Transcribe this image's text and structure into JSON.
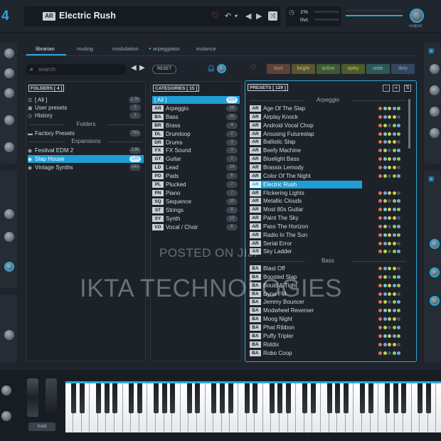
{
  "header": {
    "logo_number": "4",
    "preset_category_tag": "AR",
    "preset_name": "Electric Rush",
    "meter_line1": "1%",
    "meter_line2": "0vc",
    "output_label": "output"
  },
  "tabs": [
    "librarian",
    "routing",
    "modulation",
    "arpeggiator",
    "instance"
  ],
  "search": {
    "placeholder": "search"
  },
  "reset_label": "RESET",
  "tag_filters": [
    {
      "label": "dark",
      "color": "#5a4338",
      "text": "#c08a73"
    },
    {
      "label": "bright",
      "color": "#5a5530",
      "text": "#c8c070"
    },
    {
      "label": "active",
      "color": "#3f5a33",
      "text": "#8fcc6a"
    },
    {
      "label": "spiky",
      "color": "#4d5a2b",
      "text": "#b5cf5c"
    },
    {
      "label": "wide",
      "color": "#2f5658",
      "text": "#6fc7cb"
    },
    {
      "label": "dirty",
      "color": "#34465e",
      "text": "#84a6d6"
    }
  ],
  "folders": {
    "header": "FOLDERS [ 4 ]",
    "top_items": [
      {
        "label": "[ All ]",
        "count": "1.7k",
        "icon": "list-icon"
      },
      {
        "label": "User presets",
        "count": "0",
        "icon": "user-icon"
      },
      {
        "label": "History",
        "count": "1",
        "icon": "clock-icon"
      }
    ],
    "folders_heading": "Folders",
    "factory": {
      "label": "Factory Presets",
      "count": "763"
    },
    "expansions_heading": "Expansions",
    "expansions": [
      {
        "label": "Festival EDM 2",
        "count": "136"
      },
      {
        "label": "Slap House",
        "count": "129",
        "selected": true
      },
      {
        "label": "Vintage Synths",
        "count": "540"
      }
    ]
  },
  "categories": {
    "header": "CATEGORIES [ 15 ]",
    "items": [
      {
        "abbr": "",
        "label": "[ All ]",
        "count": "129",
        "selected": true
      },
      {
        "abbr": "AR",
        "label": "Arpeggio",
        "count": "18"
      },
      {
        "abbr": "BA",
        "label": "Bass",
        "count": "20"
      },
      {
        "abbr": "BR",
        "label": "Brass",
        "count": "4"
      },
      {
        "abbr": "DL",
        "label": "Drumloop",
        "count": "2"
      },
      {
        "abbr": "DR",
        "label": "Drums",
        "count": "3"
      },
      {
        "abbr": "FX",
        "label": "FX Sound",
        "count": "3"
      },
      {
        "abbr": "GT",
        "label": "Guitar",
        "count": "2"
      },
      {
        "abbr": "LD",
        "label": "Lead",
        "count": "14"
      },
      {
        "abbr": "PD",
        "label": "Pads",
        "count": "6"
      },
      {
        "abbr": "PL",
        "label": "Plucked",
        "count": "7"
      },
      {
        "abbr": "PN",
        "label": "Piano",
        "count": "7"
      },
      {
        "abbr": "SQ",
        "label": "Sequence",
        "count": "20"
      },
      {
        "abbr": "ST",
        "label": "Strings",
        "count": "8"
      },
      {
        "abbr": "SY",
        "label": "Synth",
        "count": "13"
      },
      {
        "abbr": "VO",
        "label": "Vocal / Choir",
        "count": "6"
      }
    ]
  },
  "presets": {
    "header": "PRESETS [ 129 ]",
    "buttons": [
      "-",
      "+",
      "⇅"
    ],
    "section_arpeggio": "Arpeggio",
    "arpeggio": [
      {
        "abbr": "AR",
        "label": "Age Of The Slap"
      },
      {
        "abbr": "AR",
        "label": "Airplay Knock"
      },
      {
        "abbr": "AR",
        "label": "Android Vocal Chop"
      },
      {
        "abbr": "AR",
        "label": "Arousing Futureslap"
      },
      {
        "abbr": "AR",
        "label": "Ballistic Slap"
      },
      {
        "abbr": "AR",
        "label": "Beefy Machine"
      },
      {
        "abbr": "AR",
        "label": "Bluelight Bass"
      },
      {
        "abbr": "AR",
        "label": "Brassix Lemody"
      },
      {
        "abbr": "AR",
        "label": "Color Of The Night"
      },
      {
        "abbr": "AR",
        "label": "Electric Rush",
        "selected": true
      },
      {
        "abbr": "AR",
        "label": "Flickering Lights"
      },
      {
        "abbr": "AR",
        "label": "Metallic Clouds"
      },
      {
        "abbr": "AR",
        "label": "Most 80s Guitar"
      },
      {
        "abbr": "AR",
        "label": "Paint The Sky"
      },
      {
        "abbr": "AR",
        "label": "Pass The Horizon"
      },
      {
        "abbr": "AR",
        "label": "Radio In The Sun"
      },
      {
        "abbr": "AR",
        "label": "Serial Error"
      },
      {
        "abbr": "AR",
        "label": "Sky Ladder"
      }
    ],
    "section_bass": "Bass",
    "bass": [
      {
        "abbr": "BA",
        "label": "Blast Off"
      },
      {
        "abbr": "BA",
        "label": "Boosted Slap"
      },
      {
        "abbr": "BA",
        "label": "Bould & Tight"
      },
      {
        "abbr": "BA",
        "label": "Dyno FM"
      },
      {
        "abbr": "BA",
        "label": "Jemmy Bouncer"
      },
      {
        "abbr": "BA",
        "label": "Modwheel Reverser"
      },
      {
        "abbr": "BA",
        "label": "Moog Night"
      },
      {
        "abbr": "BA",
        "label": "Phat Ribbon"
      },
      {
        "abbr": "BA",
        "label": "Puffy Tripler"
      },
      {
        "abbr": "BA",
        "label": "Riddix"
      },
      {
        "abbr": "BA",
        "label": "Robo Coop"
      }
    ]
  },
  "tag_dot_colors": [
    "#e0724a",
    "#d9c74a",
    "#8fcc5a",
    "#b5d65a",
    "#6fd0d4",
    "#7aa8e0",
    "#4a525b"
  ],
  "watermark": {
    "line1": "POSTED ON JIJI",
    "line2": "IKTA TECHNOLOGIES"
  },
  "keyboard": {
    "hold_label": "hold"
  }
}
